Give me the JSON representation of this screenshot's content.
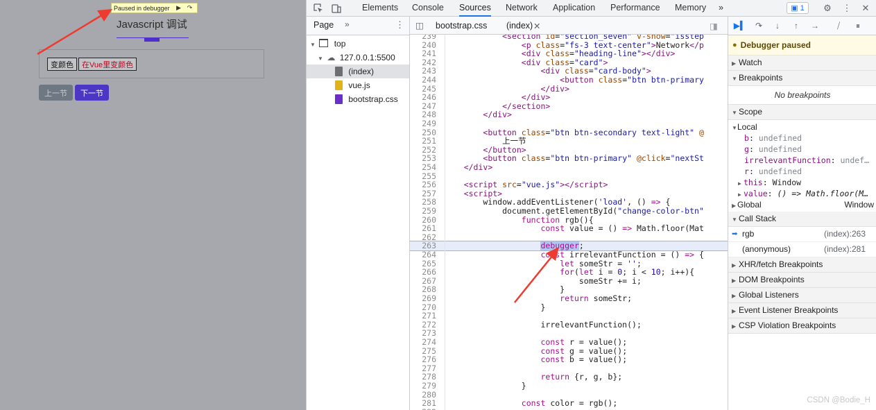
{
  "webpage": {
    "paused_banner": "Paused in debugger",
    "title": "Javascript 调试",
    "buttons": {
      "change_color": "变颜色",
      "vue_change_color": "在Vue里变颜色",
      "prev": "上一节",
      "next": "下一节"
    }
  },
  "devtools": {
    "tabs": [
      "Elements",
      "Console",
      "Sources",
      "Network",
      "Application",
      "Performance",
      "Memory"
    ],
    "active_tab": "Sources",
    "more_tabs": "»",
    "issues_count": "1",
    "navigator": {
      "tab": "Page",
      "more": "»",
      "tree": [
        {
          "label": "top",
          "type": "frame"
        },
        {
          "label": "127.0.0.1:5500",
          "type": "origin"
        },
        {
          "label": "(index)",
          "type": "file-html"
        },
        {
          "label": "vue.js",
          "type": "file-js"
        },
        {
          "label": "bootstrap.css",
          "type": "file-css"
        }
      ]
    },
    "editor": {
      "tabs": [
        "bootstrap.css",
        "(index)"
      ],
      "active_tab": "(index)",
      "highlight_line": 263,
      "lines": [
        {
          "n": 239,
          "html": "            <span class='tag'>&lt;section</span> <span class='attr'>id</span>=<span class='str'>\"section_seven\"</span> <span class='attr'>v-show</span>=<span class='str'>\"isstep</span>"
        },
        {
          "n": 240,
          "html": "                <span class='tag'>&lt;p</span> <span class='attr'>class</span>=<span class='str'>\"fs-3 text-center\"</span><span class='tag'>&gt;</span>Network<span class='tag'>&lt;/p</span>"
        },
        {
          "n": 241,
          "html": "                <span class='tag'>&lt;div</span> <span class='attr'>class</span>=<span class='str'>\"heading-line\"</span><span class='tag'>&gt;&lt;/div&gt;</span>"
        },
        {
          "n": 242,
          "html": "                <span class='tag'>&lt;div</span> <span class='attr'>class</span>=<span class='str'>\"card\"</span><span class='tag'>&gt;</span>"
        },
        {
          "n": 243,
          "html": "                    <span class='tag'>&lt;div</span> <span class='attr'>class</span>=<span class='str'>\"card-body\"</span><span class='tag'>&gt;</span>"
        },
        {
          "n": 244,
          "html": "                        <span class='tag'>&lt;button</span> <span class='attr'>class</span>=<span class='str'>\"btn btn-primary</span>"
        },
        {
          "n": 245,
          "html": "                    <span class='tag'>&lt;/div&gt;</span>"
        },
        {
          "n": 246,
          "html": "                <span class='tag'>&lt;/div&gt;</span>"
        },
        {
          "n": 247,
          "html": "            <span class='tag'>&lt;/section&gt;</span>"
        },
        {
          "n": 248,
          "html": "        <span class='tag'>&lt;/div&gt;</span>"
        },
        {
          "n": 249,
          "html": ""
        },
        {
          "n": 250,
          "html": "        <span class='tag'>&lt;button</span> <span class='attr'>class</span>=<span class='str'>\"btn btn-secondary text-light\"</span> <span class='attr'>@</span>"
        },
        {
          "n": 251,
          "html": "            上一节"
        },
        {
          "n": 252,
          "html": "        <span class='tag'>&lt;/button&gt;</span>"
        },
        {
          "n": 253,
          "html": "        <span class='tag'>&lt;button</span> <span class='attr'>class</span>=<span class='str'>\"btn btn-primary\"</span> <span class='attr'>@click</span>=<span class='str'>\"nextSt</span>"
        },
        {
          "n": 254,
          "html": "    <span class='tag'>&lt;/div&gt;</span>"
        },
        {
          "n": 255,
          "html": ""
        },
        {
          "n": 256,
          "html": "    <span class='tag'>&lt;script</span> <span class='attr'>src</span>=<span class='str'>\"vue.js\"</span><span class='tag'>&gt;&lt;/script&gt;</span>"
        },
        {
          "n": 257,
          "html": "    <span class='tag'>&lt;script&gt;</span>"
        },
        {
          "n": 258,
          "html": "        window.addEventListener(<span class='str'>'load'</span>, () <span class='kw'>=&gt;</span> {"
        },
        {
          "n": 259,
          "html": "            document.getElementById(<span class='str'>\"change-color-btn\"</span>"
        },
        {
          "n": 260,
          "html": "                <span class='kw'>function</span> rgb(){"
        },
        {
          "n": 261,
          "html": "                    <span class='kw'>const</span> value = () <span class='kw'>=&gt;</span> Math.floor(Mat"
        },
        {
          "n": 262,
          "html": ""
        },
        {
          "n": 263,
          "html": "                    <span class='kw dbg'>debugger</span>;"
        },
        {
          "n": 264,
          "html": "                    <span class='kw'>const</span> irrelevantFunction = () <span class='kw'>=&gt;</span> {"
        },
        {
          "n": 265,
          "html": "                        <span class='kw'>let</span> someStr = <span class='str'>''</span>;"
        },
        {
          "n": 266,
          "html": "                        <span class='kw'>for</span>(<span class='kw'>let</span> i = <span class='num'>0</span>; i &lt; <span class='num'>10</span>; i++){"
        },
        {
          "n": 267,
          "html": "                            someStr += i;"
        },
        {
          "n": 268,
          "html": "                        }"
        },
        {
          "n": 269,
          "html": "                        <span class='kw'>return</span> someStr;"
        },
        {
          "n": 270,
          "html": "                    }"
        },
        {
          "n": 271,
          "html": ""
        },
        {
          "n": 272,
          "html": "                    irrelevantFunction();"
        },
        {
          "n": 273,
          "html": ""
        },
        {
          "n": 274,
          "html": "                    <span class='kw'>const</span> r = value();"
        },
        {
          "n": 275,
          "html": "                    <span class='kw'>const</span> g = value();"
        },
        {
          "n": 276,
          "html": "                    <span class='kw'>const</span> b = value();"
        },
        {
          "n": 277,
          "html": ""
        },
        {
          "n": 278,
          "html": "                    <span class='kw'>return</span> {r, g, b};"
        },
        {
          "n": 279,
          "html": "                }"
        },
        {
          "n": 280,
          "html": ""
        },
        {
          "n": 281,
          "html": "                <span class='kw'>const</span> color = rgb();"
        },
        {
          "n": 282,
          "html": ""
        }
      ]
    },
    "debugger": {
      "paused_message": "Debugger paused",
      "sections": {
        "watch": "Watch",
        "breakpoints": "Breakpoints",
        "no_breakpoints": "No breakpoints",
        "scope": "Scope",
        "call_stack": "Call Stack",
        "xhr": "XHR/fetch Breakpoints",
        "dom": "DOM Breakpoints",
        "global_listeners": "Global Listeners",
        "event_listener": "Event Listener Breakpoints",
        "csp": "CSP Violation Breakpoints"
      },
      "scope": {
        "local_label": "Local",
        "vars": [
          {
            "name": "b",
            "value": "undefined"
          },
          {
            "name": "g",
            "value": "undefined"
          },
          {
            "name": "irrelevantFunction",
            "value": "undef…"
          },
          {
            "name": "r",
            "value": "undefined"
          }
        ],
        "this_label": "this",
        "this_value": "Window",
        "value_label": "value",
        "value_value": "() => Math.floor(M…",
        "global_label": "Global",
        "global_value": "Window"
      },
      "call_stack": [
        {
          "fn": "rgb",
          "loc": "(index):263",
          "current": true
        },
        {
          "fn": "(anonymous)",
          "loc": "(index):281",
          "current": false
        }
      ]
    }
  },
  "watermark": "CSDN @Bodie_H",
  "colors": {
    "accent": "#1a73e8",
    "arrow": "#ee3b2f",
    "paused_bg": "#fffbe5",
    "highlight": "#e6ecfa"
  }
}
